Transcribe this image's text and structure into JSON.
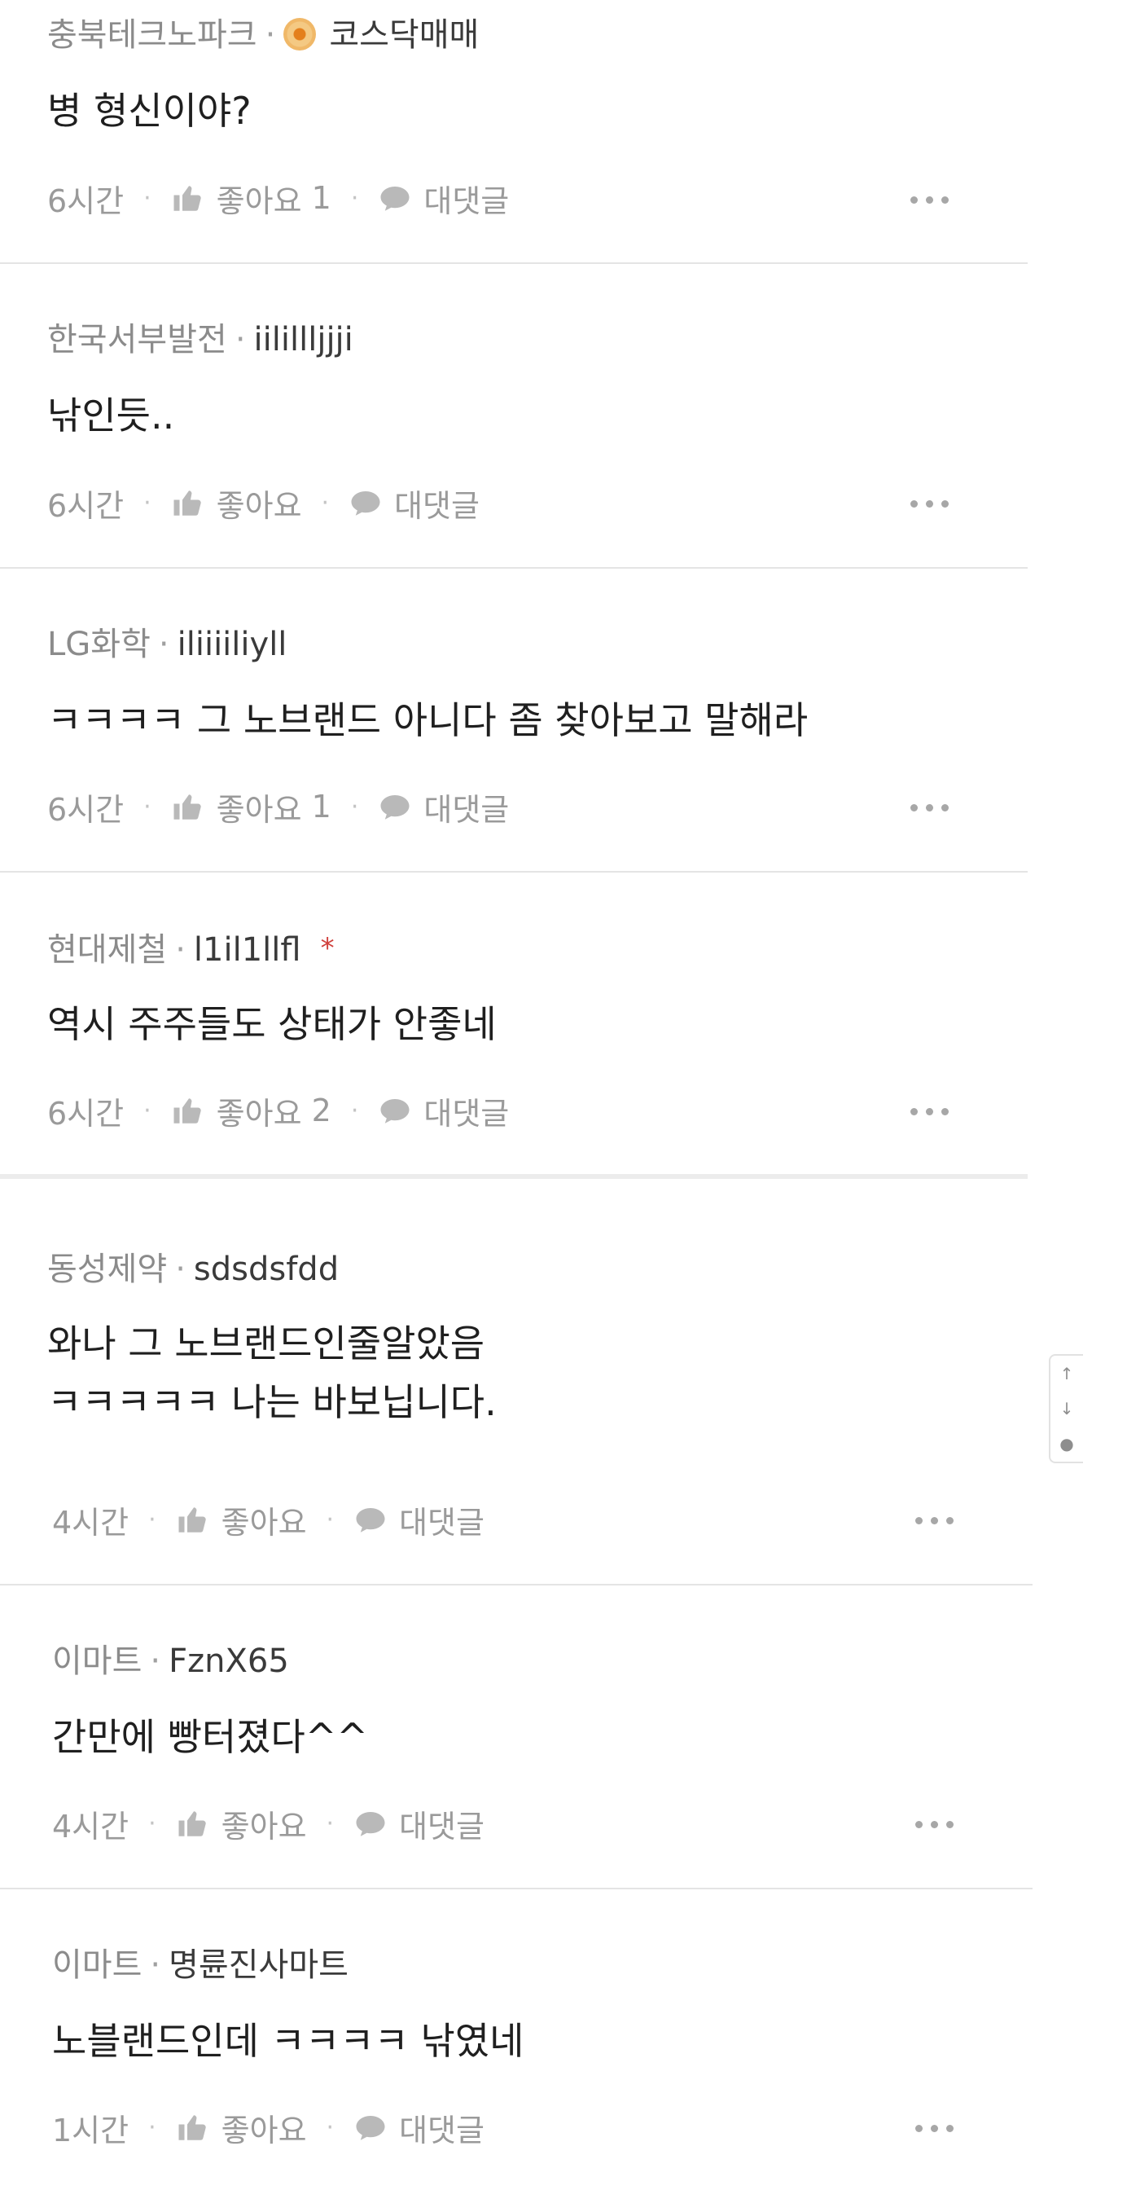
{
  "comments": [
    {
      "company": "충북테크노파크",
      "author": "코스닥매매",
      "badge": "gold-medal-icon",
      "body": "병 형신이야?",
      "time": "6시간",
      "like_label": "좋아요",
      "like_count": "1",
      "reply_label": "대댓글"
    },
    {
      "company": "한국서부발전",
      "author": "iilillljjji",
      "body": "낚인듯..",
      "time": "6시간",
      "like_label": "좋아요",
      "like_count": "",
      "reply_label": "대댓글"
    },
    {
      "company": "LG화학",
      "author": "iliiiiliyll",
      "body": "ㅋㅋㅋㅋ 그 노브랜드 아니다 좀 찾아보고 말해라",
      "time": "6시간",
      "like_label": "좋아요",
      "like_count": "1",
      "reply_label": "대댓글"
    },
    {
      "company": "현대제철",
      "author": "l1il1llfl",
      "star": "*",
      "body": "역시 주주들도 상태가 안좋네",
      "time": "6시간",
      "like_label": "좋아요",
      "like_count": "2",
      "reply_label": "대댓글"
    },
    {
      "company": "동성제약",
      "author": "sdsdsfdd",
      "body": "와나 그 노브랜드인줄알았음\nㅋㅋㅋㅋㅋ 나는 바보닙니다.",
      "time": "4시간",
      "like_label": "좋아요",
      "like_count": "",
      "reply_label": "대댓글"
    },
    {
      "company": "이마트",
      "author": "FznX65",
      "body": "간만에 빵터졌다^^",
      "time": "4시간",
      "like_label": "좋아요",
      "like_count": "",
      "reply_label": "대댓글"
    },
    {
      "company": "이마트",
      "author": "명륜진사마트",
      "body": "노블랜드인데 ㅋㅋㅋㅋ 낚였네",
      "time": "1시간",
      "like_label": "좋아요",
      "like_count": "",
      "reply_label": "대댓글"
    }
  ],
  "side_widget": {
    "up": "↑",
    "down": "↓",
    "comment": "●"
  },
  "colors": {
    "meta": "#8b8b8b",
    "author": "#3a3a3a",
    "body": "#1f1f1f",
    "action": "#9a9a9a",
    "divider": "#e4e4e4",
    "star": "#d0403c",
    "badge": "#f0b868"
  }
}
